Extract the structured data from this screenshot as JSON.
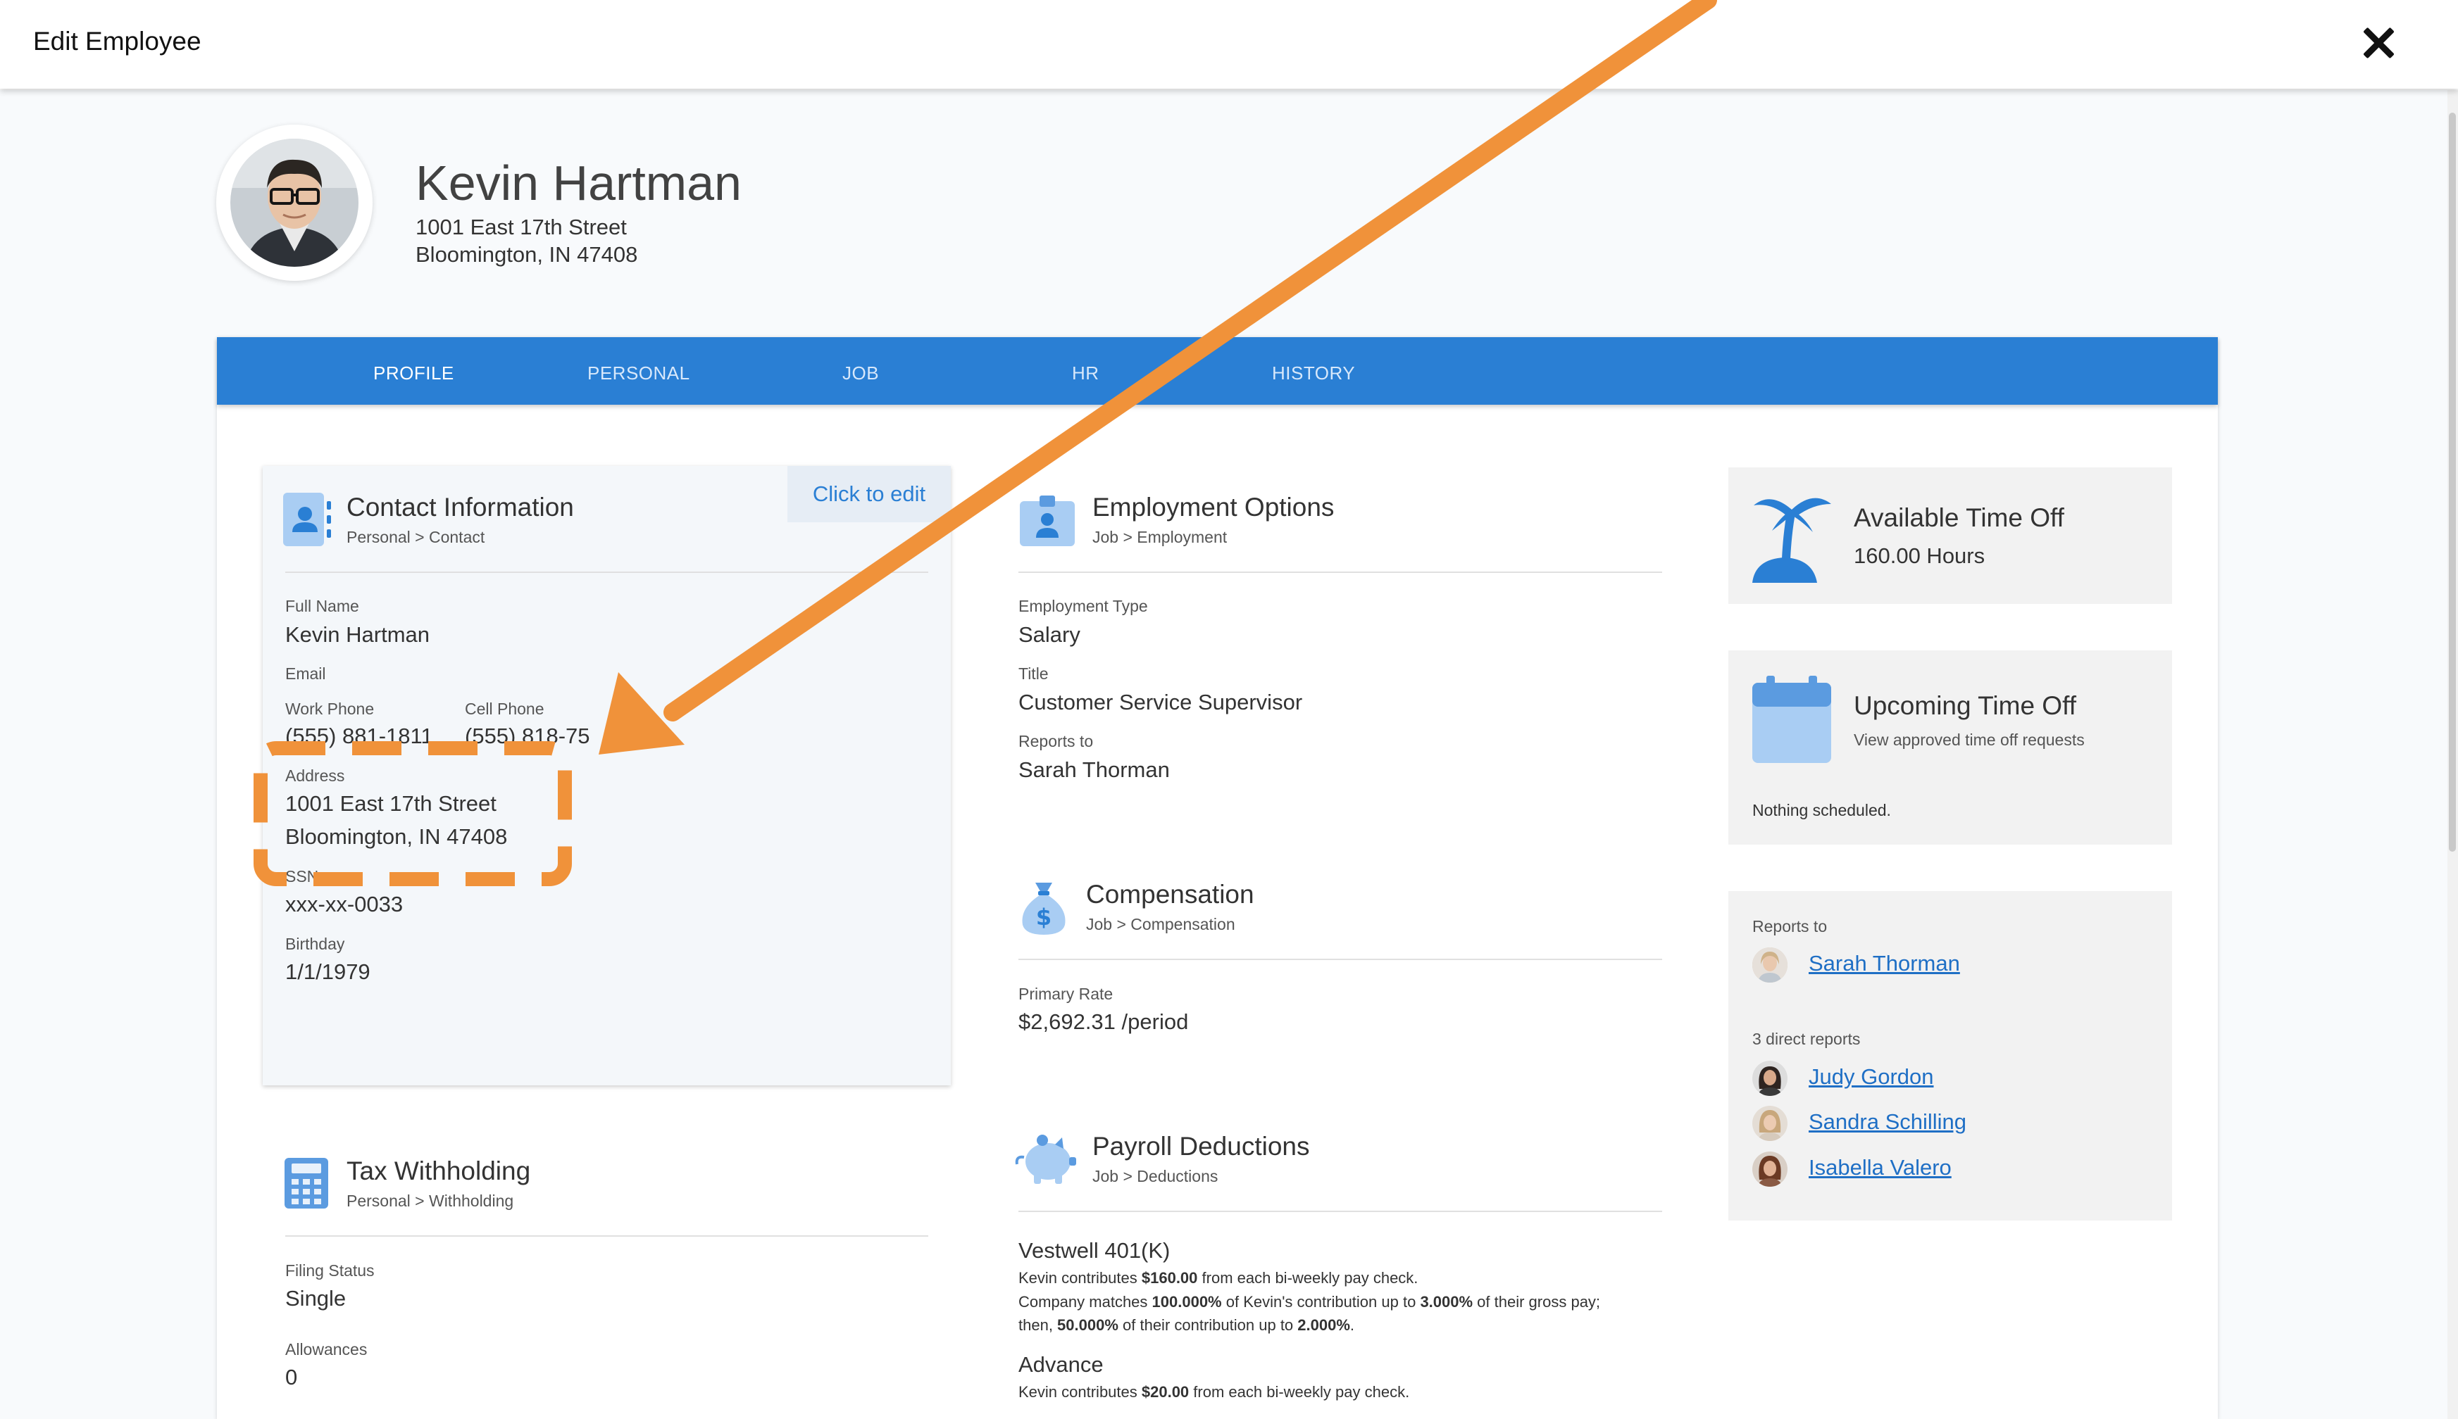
{
  "window": {
    "title": "Edit Employee"
  },
  "employee": {
    "name": "Kevin Hartman",
    "address_line1": "1001 East 17th Street",
    "address_line2": "Bloomington, IN 47408"
  },
  "tabs": [
    {
      "label": "PROFILE",
      "active": true
    },
    {
      "label": "PERSONAL"
    },
    {
      "label": "JOB"
    },
    {
      "label": "HR"
    },
    {
      "label": "HISTORY"
    }
  ],
  "contact": {
    "title": "Contact Information",
    "path": "Personal > Contact",
    "edit_label": "Click to edit",
    "full_name_label": "Full Name",
    "full_name": "Kevin Hartman",
    "email_label": "Email",
    "work_phone_label": "Work Phone",
    "work_phone": "(555) 881-1811",
    "cell_phone_label": "Cell Phone",
    "cell_phone": "(555) 818-75",
    "address_label": "Address",
    "address_line1": "1001 East 17th Street",
    "address_line2": "Bloomington, IN 47408",
    "ssn_label": "SSN",
    "ssn": "xxx-xx-0033",
    "birthday_label": "Birthday",
    "birthday": "1/1/1979"
  },
  "tax": {
    "title": "Tax Withholding",
    "path": "Personal > Withholding",
    "filing_status_label": "Filing Status",
    "filing_status": "Single",
    "allowances_label": "Allowances",
    "allowances": "0"
  },
  "employment": {
    "title": "Employment Options",
    "path": "Job > Employment",
    "type_label": "Employment Type",
    "type": "Salary",
    "title_label": "Title",
    "job_title": "Customer Service Supervisor",
    "reports_to_label": "Reports to",
    "reports_to": "Sarah Thorman"
  },
  "compensation": {
    "title": "Compensation",
    "path": "Job > Compensation",
    "rate_label": "Primary Rate",
    "rate": "$2,692.31 /period"
  },
  "deductions": {
    "title": "Payroll Deductions",
    "path": "Job > Deductions",
    "items": [
      {
        "name": "Vestwell 401(K)",
        "line1_a": "Kevin contributes ",
        "line1_b": "$160.00",
        "line1_c": " from each bi-weekly pay check.",
        "line2_a": "Company matches ",
        "line2_b": "100.000%",
        "line2_c": " of Kevin's contribution up to ",
        "line2_d": "3.000%",
        "line2_e": " of their gross pay;",
        "line3_a": "then, ",
        "line3_b": "50.000%",
        "line3_c": " of their contribution up to ",
        "line3_d": "2.000%",
        "line3_e": "."
      },
      {
        "name": "Advance",
        "line1_a": "Kevin contributes ",
        "line1_b": "$20.00",
        "line1_c": " from each bi-weekly pay check."
      }
    ]
  },
  "time_off": {
    "title": "Available Time Off",
    "hours": "160.00 Hours"
  },
  "upcoming": {
    "title": "Upcoming Time Off",
    "subtitle": "View approved time off requests",
    "empty": "Nothing scheduled."
  },
  "org": {
    "reports_to_label": "Reports to",
    "manager": "Sarah Thorman",
    "direct_reports_label": "3 direct reports",
    "reports": [
      "Judy Gordon",
      "Sandra Schilling",
      "Isabella Valero"
    ]
  },
  "colors": {
    "accent": "#2a7fd4",
    "annotation": "#f0923a",
    "icon_blue": "#5b9be0"
  },
  "icons": [
    "close-icon",
    "contact-card-icon",
    "id-badge-icon",
    "money-bag-icon",
    "piggy-bank-icon",
    "calculator-icon",
    "palm-tree-icon",
    "calendar-icon"
  ]
}
